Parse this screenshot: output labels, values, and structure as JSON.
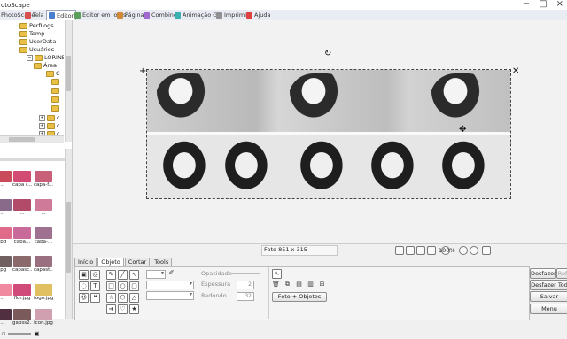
{
  "window": {
    "title": "otoScape",
    "controls": [
      "−",
      "□",
      "×"
    ]
  },
  "tabs": [
    {
      "label": "PhotoScape",
      "active": false,
      "color": "#6a8fcf"
    },
    {
      "label": "Tela",
      "active": false,
      "color": "#d95050"
    },
    {
      "label": "Editor",
      "active": true,
      "color": "#4a7fd0"
    },
    {
      "label": "Editor em lotes",
      "active": false,
      "color": "#5aa05a"
    },
    {
      "label": "Página",
      "active": false,
      "color": "#d08a3a"
    },
    {
      "label": "Combine",
      "active": false,
      "color": "#a06ad0"
    },
    {
      "label": "Animação Gif",
      "active": false,
      "color": "#3ab0b0"
    },
    {
      "label": "Imprimir",
      "active": false,
      "color": "#909090"
    },
    {
      "label": "Ajuda",
      "active": false,
      "color": "#e04040"
    }
  ],
  "tree": {
    "items": [
      {
        "label": "PerfLogs"
      },
      {
        "label": "Temp"
      },
      {
        "label": "UserData"
      },
      {
        "label": "Usuários"
      },
      {
        "label": "LORINE"
      },
      {
        "label": "Área"
      },
      {
        "label": "C"
      },
      {
        "label": "c"
      },
      {
        "label": "c"
      },
      {
        "label": "c"
      }
    ]
  },
  "thumbnails": [
    {
      "label": "...",
      "color": "#c94a5a"
    },
    {
      "label": "capa (...",
      "color": "#d24b72"
    },
    {
      "label": "capa-f...",
      "color": "#c9607a"
    },
    {
      "label": "...",
      "color": "#8a6a8a"
    },
    {
      "label": "...",
      "color": "#b24a6a"
    },
    {
      "label": "...",
      "color": "#d07a9a"
    },
    {
      "label": "jpg",
      "color": "#e06a8a"
    },
    {
      "label": "capa...",
      "color": "#c86a9a"
    },
    {
      "label": "capa-...",
      "color": "#a07090"
    },
    {
      "label": "jpg",
      "color": "#706060"
    },
    {
      "label": "capasc...",
      "color": "#8a6a6a"
    },
    {
      "label": "capast...",
      "color": "#9a7080"
    },
    {
      "label": "...",
      "color": "#f08aa0"
    },
    {
      "label": "flor.jpg",
      "color": "#d04a7a"
    },
    {
      "label": "fogo.jpg",
      "color": "#e0c060"
    },
    {
      "label": "...",
      "color": "#503040"
    },
    {
      "label": "gabss2...",
      "color": "#7a5a5a"
    },
    {
      "label": "icon.jpg",
      "color": "#d0a0b0"
    }
  ],
  "editor": {
    "photo_info": "Foto 851 x 315",
    "zoom": "100%"
  },
  "context_tabs": [
    {
      "label": "Início",
      "active": false
    },
    {
      "label": "Objeto",
      "active": true
    },
    {
      "label": "Cortar",
      "active": false
    },
    {
      "label": "Tools",
      "active": false
    }
  ],
  "object_panel": {
    "opacity_label": "Opacidade",
    "thickness_label": "Espessura",
    "thickness_value": "2",
    "rounded_label": "Redondo",
    "rounded_value": "32",
    "photo_objects_button": "Foto + Objetos"
  },
  "right_buttons": {
    "undo": "Desfazer",
    "redo": "Ref",
    "undo_all": "Desfazer Tod",
    "save": "Salvar",
    "menu": "Menu"
  }
}
